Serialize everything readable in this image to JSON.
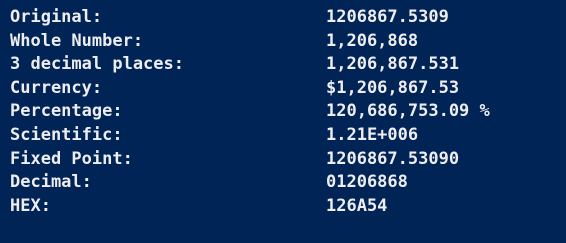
{
  "console": {
    "rows": [
      {
        "label": "Original:",
        "value": "1206867.5309"
      },
      {
        "label": "Whole Number:",
        "value": "1,206,868"
      },
      {
        "label": "3 decimal places:",
        "value": "1,206,867.531"
      },
      {
        "label": "Currency:",
        "value": "$1,206,867.53"
      },
      {
        "label": "Percentage:",
        "value": "120,686,753.09 %"
      },
      {
        "label": "Scientific:",
        "value": "1.21E+006"
      },
      {
        "label": "Fixed Point:",
        "value": "1206867.53090"
      },
      {
        "label": "Decimal:",
        "value": "01206868"
      },
      {
        "label": "HEX:",
        "value": "126A54"
      }
    ]
  },
  "colors": {
    "background": "#012456",
    "text": "#eeedf0"
  }
}
